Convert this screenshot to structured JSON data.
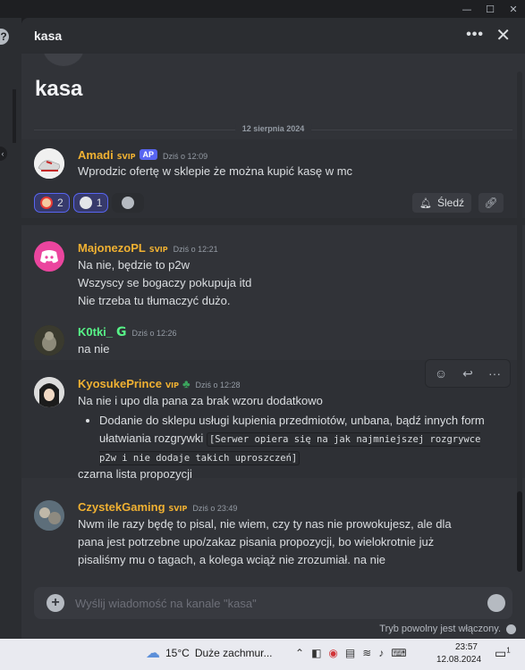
{
  "window": {
    "controls": [
      "—",
      "☐",
      "✕"
    ]
  },
  "header": {
    "title": "kasa"
  },
  "thread": {
    "name": "kasa",
    "date_divider": "12 sierpnia 2024"
  },
  "starter": {
    "user": "Amadi",
    "tag": "SVIP",
    "badge": "AP",
    "time": "Dziś o 12:09",
    "text": "Wprodzic ofertę w sklepie że można kupić kasę w mc",
    "reactions": [
      {
        "emoji": "clown-face",
        "count": "2",
        "active": true
      },
      {
        "emoji": "skull",
        "count": "1",
        "active": true
      }
    ],
    "follow_label": "Śledź"
  },
  "messages": [
    {
      "user": "MajonezoPL",
      "tag": "SVIP",
      "time": "Dziś o 12:21",
      "lines": [
        "Na nie, będzie to p2w",
        "Wszyscy se bogaczy pokupuja itd",
        "Nie trzeba tu tłumaczyć dużo."
      ]
    },
    {
      "user": "K0tki_",
      "tag": "G",
      "time": "Dziś o 12:26",
      "lines": [
        "na nie"
      ]
    },
    {
      "user": "KyosukePrince",
      "tag": "VIP",
      "time": "Dziś o 12:28",
      "lines": [
        "Na nie i upo dla pana za brak wzoru dodatkowo"
      ],
      "bullet_text": "Dodanie do sklepu usługi kupienia przedmiotów, unbana, bądź innych form ułatwiania rozgrywki",
      "bullet_code": "[Serwer opiera się na jak najmniejszej rozgrywce p2w i nie dodaje takich uproszczeń]",
      "after": "czarna lista propozycji"
    },
    {
      "user": "CzystekGaming",
      "tag": "SVIP",
      "time": "Dziś o 23:49",
      "lines": [
        "Nwm ile razy będę to pisal, nie wiem, czy ty nas nie prowokujesz, ale dla",
        "pana jest potrzebne upo/zakaz pisania propozycji, bo wielokrotnie już",
        "pisaliśmy mu o tagach, a kolega wciąż nie zrozumiał. na nie"
      ]
    }
  ],
  "composer": {
    "placeholder": "Wyślij wiadomość na kanale \"kasa\""
  },
  "slowmode": "Tryb powolny jest włączony.",
  "taskbar": {
    "temp": "15°C",
    "weather": "Duże zachmur...",
    "time": "23:57",
    "date": "12.08.2024",
    "notif_count": "1"
  },
  "colors": {
    "panel": "#313338",
    "header": "#2b2d31",
    "accent": "#5865f2",
    "gold": "#f0b132"
  }
}
